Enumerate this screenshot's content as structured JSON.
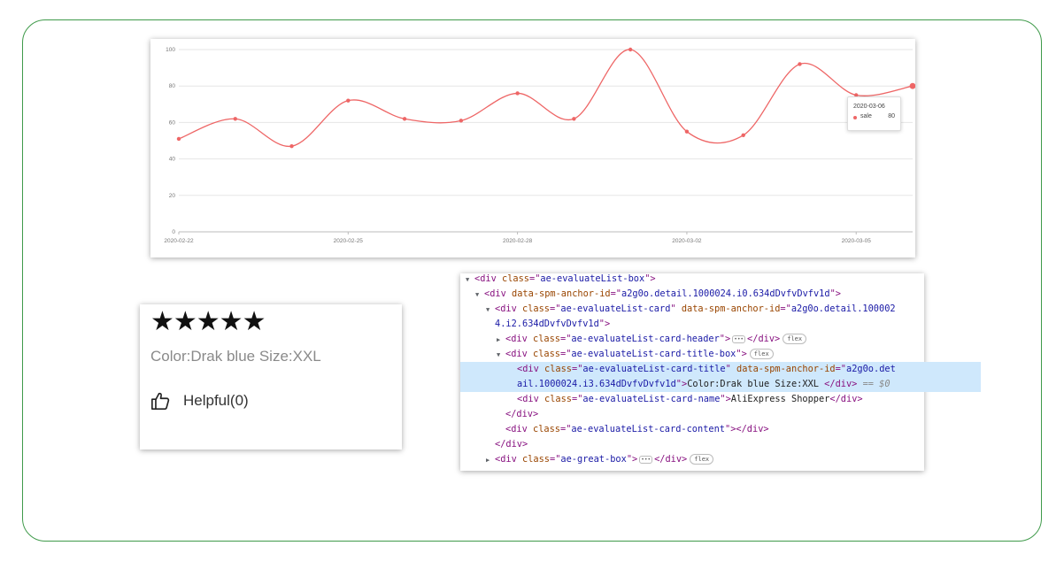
{
  "chart_data": {
    "type": "line",
    "x": [
      "2020-02-22",
      "2020-02-23",
      "2020-02-24",
      "2020-02-25",
      "2020-02-26",
      "2020-02-27",
      "2020-02-28",
      "2020-02-29",
      "2020-03-01",
      "2020-03-02",
      "2020-03-03",
      "2020-03-04",
      "2020-03-05",
      "2020-03-06"
    ],
    "series": [
      {
        "name": "sale",
        "values": [
          51,
          62,
          47,
          72,
          62,
          61,
          76,
          62,
          100,
          55,
          53,
          92,
          75,
          80
        ]
      }
    ],
    "x_tick_labels": [
      "2020-02-22",
      "2020-02-25",
      "2020-02-28",
      "2020-03-02",
      "2020-03-05"
    ],
    "y_ticks": [
      0,
      20,
      40,
      60,
      80,
      100
    ],
    "ylim": [
      0,
      100
    ],
    "grid": "horizontal",
    "line_color": "#ee6666",
    "tooltip": {
      "date": "2020-03-06",
      "series": "sale",
      "value": "80"
    }
  },
  "review": {
    "stars_count": 5,
    "stars": "★★★★★",
    "sku": "Color:Drak blue Size:XXL",
    "helpful_label": "Helpful(0)"
  },
  "devtools": {
    "l1": {
      "tag": "div",
      "attr": "class",
      "val": "ae-evaluateList-box"
    },
    "l2": {
      "tag": "div",
      "attr": "data-spm-anchor-id",
      "val": "a2g0o.detail.1000024.i0.634dDvfvDvfv1d"
    },
    "l3a": {
      "tag": "div",
      "attr1": "class",
      "val1": "ae-evaluateList-card",
      "attr2": "data-spm-anchor-id",
      "val2a": "a2g0o.detail.100002"
    },
    "l3b": {
      "val2b": "4.i2.634dDvfvDvfv1d"
    },
    "l4": {
      "tag": "div",
      "attr": "class",
      "val": "ae-evaluateList-card-header",
      "close": "</div>",
      "badge": "flex"
    },
    "l5": {
      "tag": "div",
      "attr": "class",
      "val": "ae-evaluateList-card-title-box",
      "badge": "flex"
    },
    "l6a": {
      "tag": "div",
      "attr1": "class",
      "val1": "ae-evaluateList-card-title",
      "attr2": "data-spm-anchor-id",
      "val2a": "a2g0o.det"
    },
    "l6b": {
      "val2b": "ail.1000024.i3.634dDvfvDvfv1d",
      "text": "Color:Drak blue Size:XXL ",
      "close": "</div>",
      "marker": "== $0"
    },
    "l7": {
      "tag": "div",
      "attr": "class",
      "val": "ae-evaluateList-card-name",
      "text": "AliExpress Shopper",
      "close": "</div>"
    },
    "l8": {
      "close": "</div>"
    },
    "l9": {
      "tag": "div",
      "attr": "class",
      "val": "ae-evaluateList-card-content",
      "close": "</div>"
    },
    "l10": {
      "close": "</div>"
    },
    "l11": {
      "tag": "div",
      "attr": "class",
      "val": "ae-great-box",
      "close": "</div>",
      "badge": "flex"
    }
  }
}
